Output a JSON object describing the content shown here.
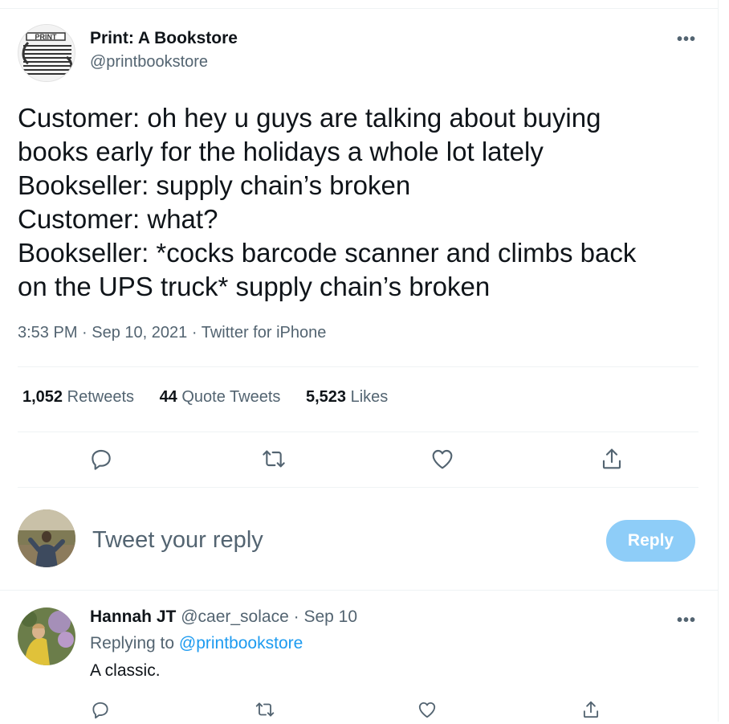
{
  "tweet": {
    "author_name": "Print: A Bookstore",
    "author_handle": "@printbookstore",
    "logo_text": "PRINT",
    "lines": [
      "Customer: oh hey u guys are talking about buying",
      "books early for the holidays a whole lot lately",
      "Bookseller: supply chain’s broken",
      "Customer: what?",
      "Bookseller: *cocks barcode scanner and climbs back",
      "on the UPS truck* supply chain’s broken"
    ],
    "time": "3:53 PM",
    "date": "Sep 10, 2021",
    "source": "Twitter for iPhone",
    "separator": "·",
    "more_label": "•••"
  },
  "stats": {
    "retweets_count": "1,052",
    "retweets_label": "Retweets",
    "quotes_count": "44",
    "quotes_label": "Quote Tweets",
    "likes_count": "5,523",
    "likes_label": "Likes"
  },
  "actions": {
    "icons": [
      "reply-icon",
      "retweet-icon",
      "like-icon",
      "share-icon"
    ]
  },
  "composer": {
    "placeholder": "Tweet your reply",
    "button_label": "Reply",
    "button_color": "#8ecdf8"
  },
  "reply": {
    "name": "Hannah JT",
    "handle": "@caer_solace",
    "separator": "·",
    "date": "Sep 10",
    "replying_prefix": "Replying to",
    "replying_to": "@printbookstore",
    "text": "A classic.",
    "more_label": "•••"
  },
  "colors": {
    "text": "#0f1419",
    "secondary": "#536471",
    "accent": "#1d9bf0",
    "divider": "#eff3f4"
  }
}
